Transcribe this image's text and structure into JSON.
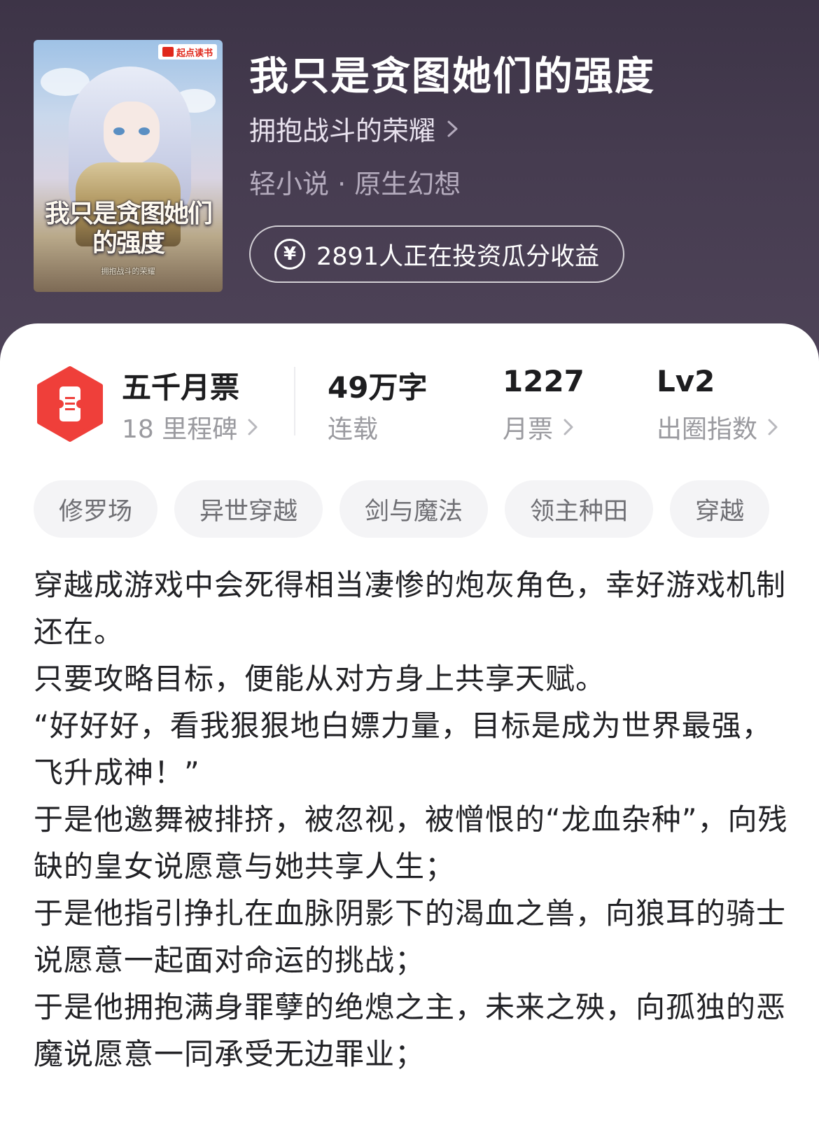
{
  "cover": {
    "badge": "起点读书",
    "title": "我只是贪图她们的强度",
    "author": "拥抱战斗的荣耀"
  },
  "book": {
    "title": "我只是贪图她们的强度",
    "author": "拥抱战斗的荣耀",
    "genre": "轻小说 · 原生幻想",
    "invest_text": "2891人正在投资瓜分收益",
    "invest_icon": "yen-coin-icon"
  },
  "stats": {
    "milestone": {
      "title": "五千月票",
      "sub": "18 里程碑"
    },
    "words": {
      "title": "49万字",
      "sub": "连载"
    },
    "monthly_ticket": {
      "title": "1227",
      "sub": "月票"
    },
    "popularity": {
      "title": "Lv2",
      "sub": "出圈指数"
    },
    "accent_color": "#ef3f3a"
  },
  "tags": [
    "修罗场",
    "异世穿越",
    "剑与魔法",
    "领主种田",
    "穿越"
  ],
  "description": [
    "穿越成游戏中会死得相当凄惨的炮灰角色，幸好游戏机制还在。",
    "只要攻略目标，便能从对方身上共享天赋。",
    "“好好好，看我狠狠地白嫖力量，目标是成为世界最强，飞升成神！”",
    "于是他邀舞被排挤，被忽视，被憎恨的“龙血杂种”，向残缺的皇女说愿意与她共享人生；",
    "于是他指引挣扎在血脉阴影下的渴血之兽，向狼耳的骑士说愿意一起面对命运的挑战；",
    "于是他拥抱满身罪孽的绝熄之主，未来之殃，向孤独的恶魔说愿意一同承受无边罪业；"
  ]
}
